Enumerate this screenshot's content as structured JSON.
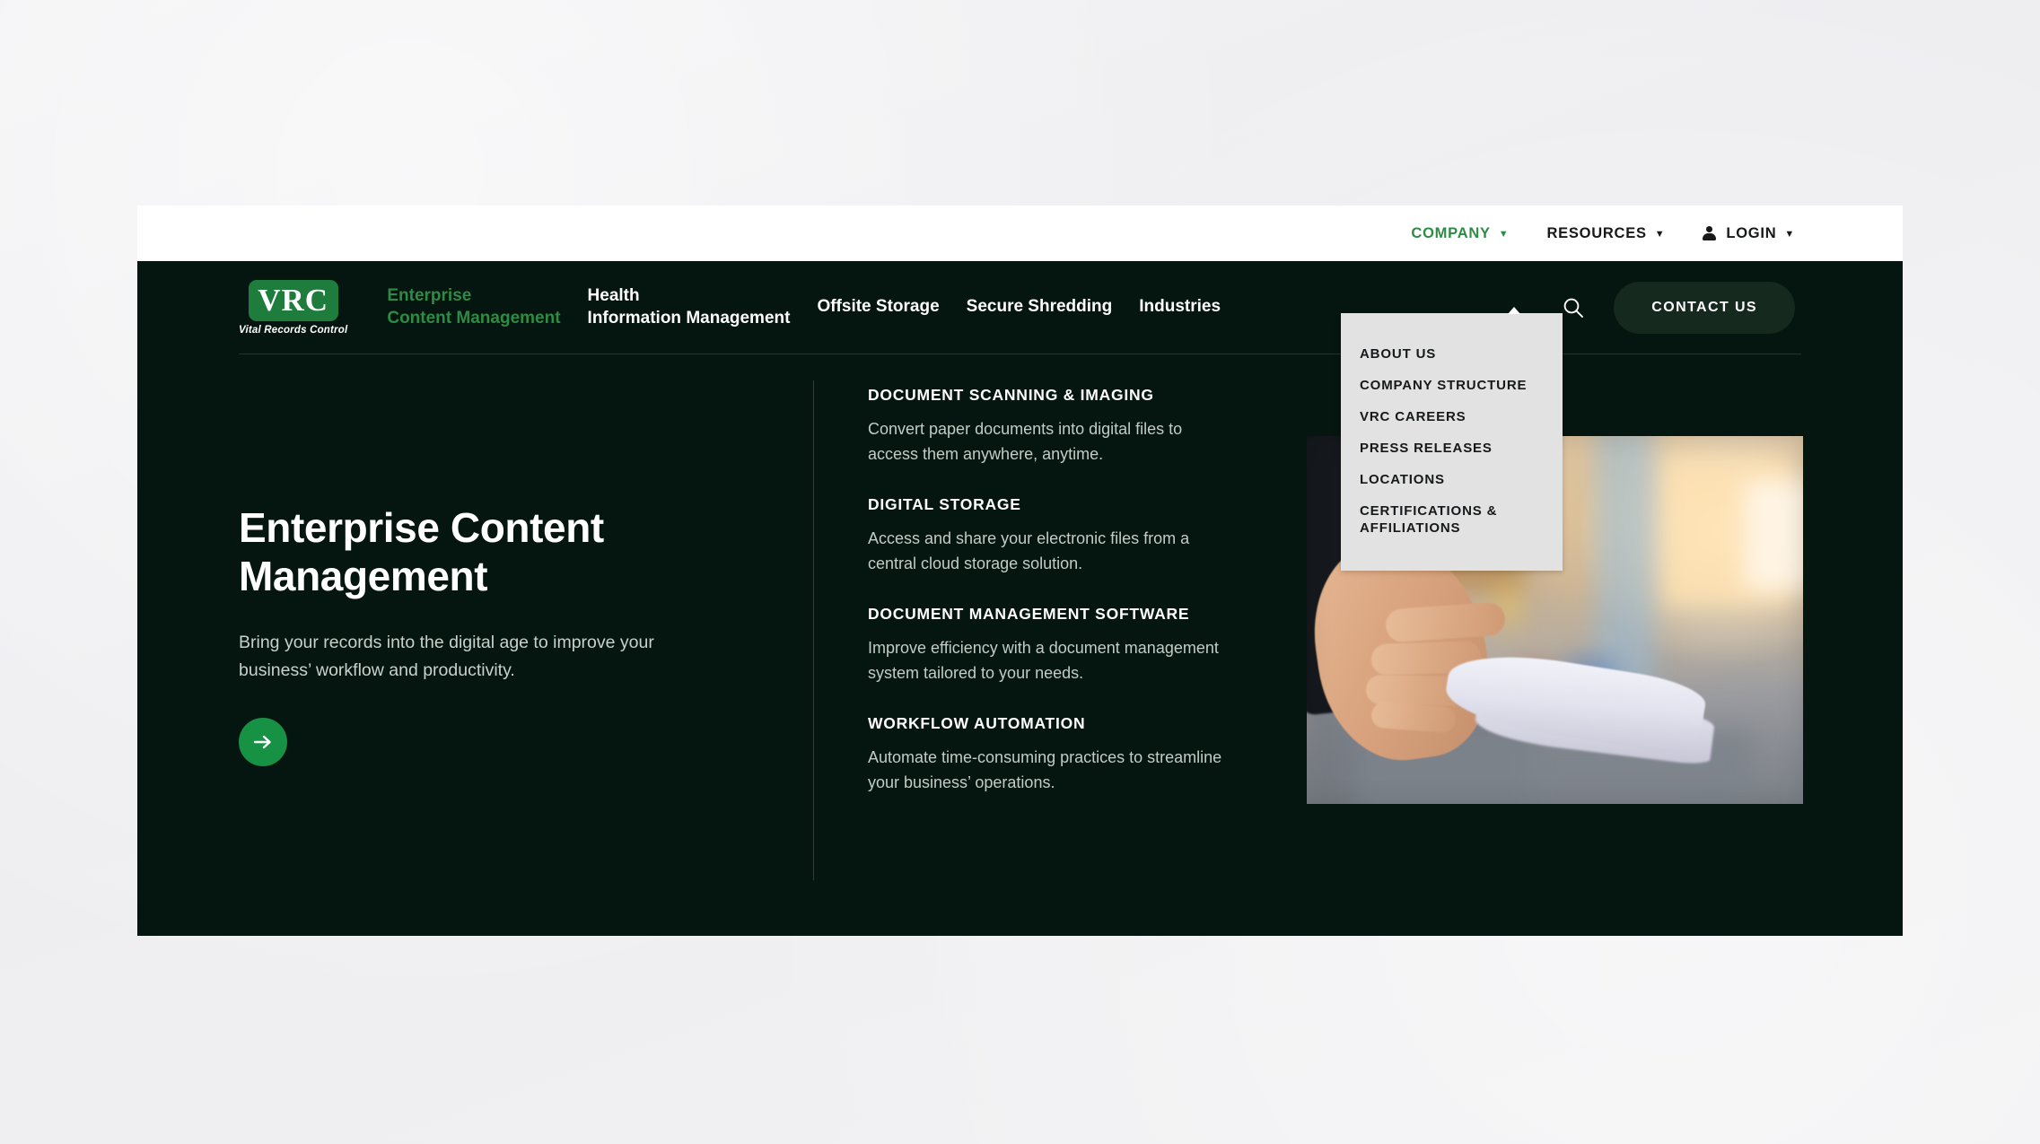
{
  "colors": {
    "page_background": "#05150f",
    "brand_green": "#1e7c3c",
    "accent_green": "#2e8b45",
    "arrow_button_green": "#179245",
    "contact_button": "#15291f",
    "dropdown_background": "#e2e2e2",
    "canvas_background": "#f0f0f2"
  },
  "utility_nav": {
    "items": [
      {
        "label": "COMPANY",
        "icon": "chevron-down-icon",
        "active": true
      },
      {
        "label": "RESOURCES",
        "icon": "chevron-down-icon",
        "active": false
      },
      {
        "label": "LOGIN",
        "icon": "person-icon",
        "active": false
      }
    ],
    "caret": "▼"
  },
  "company_dropdown": {
    "open": true,
    "items": [
      "ABOUT US",
      "COMPANY STRUCTURE",
      "VRC CAREERS",
      "PRESS RELEASES",
      "LOCATIONS",
      "CERTIFICATIONS & AFFILIATIONS"
    ]
  },
  "logo": {
    "mark": "VRC",
    "tagline": "Vital Records Control"
  },
  "main_nav": {
    "links": [
      {
        "label": "Enterprise\nContent Management",
        "active": true,
        "multiline": true
      },
      {
        "label": "Health\nInformation Management",
        "active": false,
        "multiline": true
      },
      {
        "label": "Offsite Storage",
        "active": false,
        "multiline": false
      },
      {
        "label": "Secure Shredding",
        "active": false,
        "multiline": false
      },
      {
        "label": "Industries",
        "active": false,
        "multiline": false
      }
    ],
    "search_icon": "search-icon",
    "contact_button": "CONTACT US"
  },
  "hero": {
    "title": "Enterprise Content Management",
    "subtitle": "Bring your records into the digital age to improve your business’ workflow and productivity.",
    "cta_icon": "arrow-right-icon",
    "image_alt": "Hand pulling printed pages from an office printer",
    "features": [
      {
        "title": "DOCUMENT SCANNING & IMAGING",
        "description": "Convert paper documents into digital files to access them anywhere, anytime."
      },
      {
        "title": "DIGITAL STORAGE",
        "description": "Access and share your electronic files from a central cloud storage solution."
      },
      {
        "title": "DOCUMENT MANAGEMENT SOFTWARE",
        "description": "Improve efficiency with a document management system tailored to your needs."
      },
      {
        "title": "WORKFLOW AUTOMATION",
        "description": "Automate time-consuming practices to streamline your business’ operations."
      }
    ]
  }
}
